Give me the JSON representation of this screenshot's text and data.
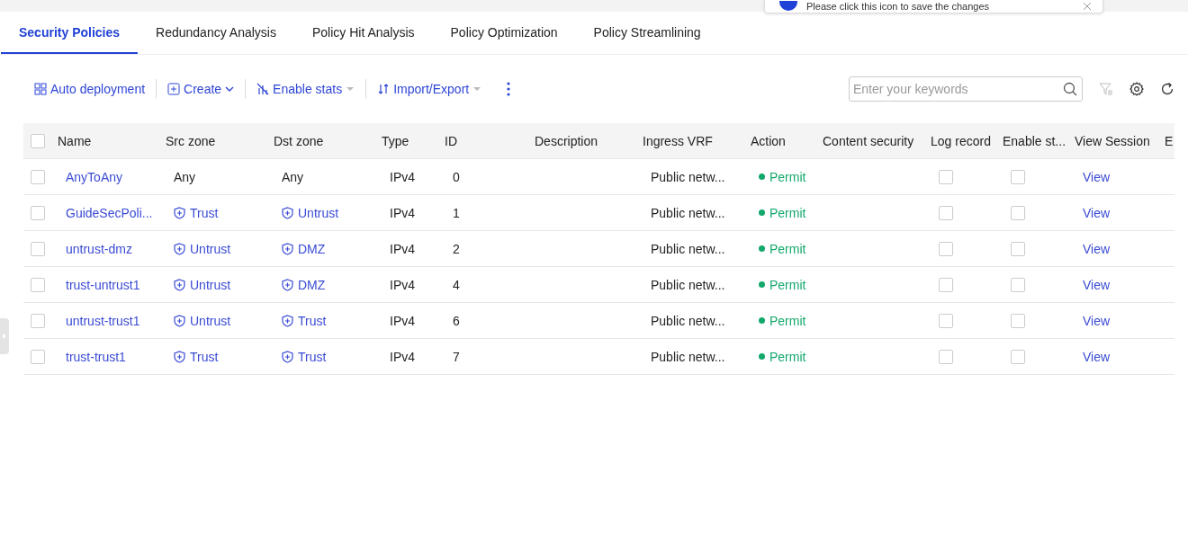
{
  "toast": {
    "message": "Please click this icon to save the changes"
  },
  "tabs": [
    {
      "label": "Security Policies",
      "selected": true
    },
    {
      "label": "Redundancy Analysis",
      "selected": false
    },
    {
      "label": "Policy Hit Analysis",
      "selected": false
    },
    {
      "label": "Policy Optimization",
      "selected": false
    },
    {
      "label": "Policy Streamlining",
      "selected": false
    }
  ],
  "toolbar": [
    {
      "kind": "grid",
      "label": "Auto deployment",
      "disabled": false
    },
    {
      "kind": "create",
      "label": "Create",
      "disabled": false
    },
    {
      "kind": "stats",
      "label": "Enable stats",
      "disabled": false
    },
    {
      "kind": "sort",
      "label": "Import/Export",
      "disabled": false
    }
  ],
  "search": {
    "placeholder": "Enter your keywords"
  },
  "table": {
    "all_checked": false,
    "columns": [
      "Name",
      "Src zone",
      "Dst zone",
      "Type",
      "ID",
      "Description",
      "Ingress VRF",
      "Action",
      "Content security",
      "Log record",
      "Enable st...",
      "View Session",
      "E"
    ],
    "rows": [
      {
        "checked": false,
        "name": "AnyToAny",
        "src": {
          "label": "Any",
          "zone": false
        },
        "dst": {
          "label": "Any",
          "zone": false
        },
        "type": "IPv4",
        "id": "0",
        "vrf": "Public netw...",
        "action": {
          "label": "Permit",
          "color": "#13a86b"
        },
        "log": false,
        "stats": false,
        "view": "View"
      },
      {
        "checked": false,
        "name": "GuideSecPoli...",
        "src": {
          "label": "Trust",
          "zone": true
        },
        "dst": {
          "label": "Untrust",
          "zone": true
        },
        "type": "IPv4",
        "id": "1",
        "vrf": "Public netw...",
        "action": {
          "label": "Permit",
          "color": "#13a86b"
        },
        "log": false,
        "stats": false,
        "view": "View"
      },
      {
        "checked": false,
        "name": "untrust-dmz",
        "src": {
          "label": "Untrust",
          "zone": true
        },
        "dst": {
          "label": "DMZ",
          "zone": true
        },
        "type": "IPv4",
        "id": "2",
        "vrf": "Public netw...",
        "action": {
          "label": "Permit",
          "color": "#13a86b"
        },
        "log": false,
        "stats": false,
        "view": "View"
      },
      {
        "checked": false,
        "name": "trust-untrust1",
        "src": {
          "label": "Untrust",
          "zone": true
        },
        "dst": {
          "label": "DMZ",
          "zone": true
        },
        "type": "IPv4",
        "id": "4",
        "vrf": "Public netw...",
        "action": {
          "label": "Permit",
          "color": "#13a86b"
        },
        "log": false,
        "stats": false,
        "view": "View"
      },
      {
        "checked": false,
        "name": "untrust-trust1",
        "src": {
          "label": "Untrust",
          "zone": true
        },
        "dst": {
          "label": "Trust",
          "zone": true
        },
        "type": "IPv4",
        "id": "6",
        "vrf": "Public netw...",
        "action": {
          "label": "Permit",
          "color": "#13a86b"
        },
        "log": false,
        "stats": false,
        "view": "View"
      },
      {
        "checked": false,
        "name": "trust-trust1",
        "src": {
          "label": "Trust",
          "zone": true
        },
        "dst": {
          "label": "Trust",
          "zone": true
        },
        "type": "IPv4",
        "id": "7",
        "vrf": "Public netw...",
        "action": {
          "label": "Permit",
          "color": "#13a86b"
        },
        "log": false,
        "stats": false,
        "view": "View"
      }
    ]
  }
}
